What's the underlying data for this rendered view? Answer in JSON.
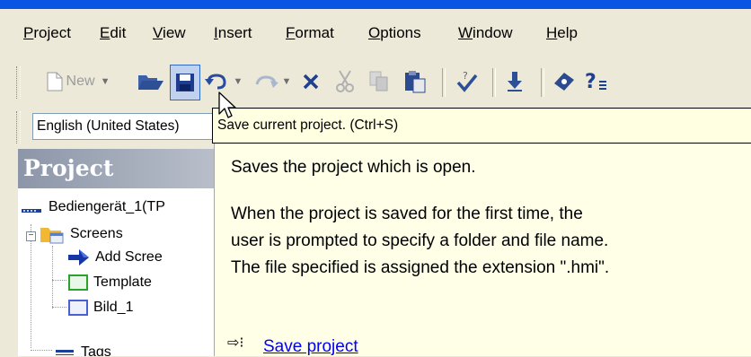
{
  "menu": [
    {
      "label": "Project",
      "mnemonic": "P"
    },
    {
      "label": "Edit",
      "mnemonic": "E"
    },
    {
      "label": "View",
      "mnemonic": "V"
    },
    {
      "label": "Insert",
      "mnemonic": "I"
    },
    {
      "label": "Format",
      "mnemonic": "F"
    },
    {
      "label": "Options",
      "mnemonic": "O"
    },
    {
      "label": "Window",
      "mnemonic": "W"
    },
    {
      "label": "Help",
      "mnemonic": "H"
    }
  ],
  "toolbar": {
    "new_label": "New",
    "icons": [
      "new-document-icon",
      "open-folder-icon",
      "save-icon",
      "undo-icon",
      "redo-icon",
      "delete-icon",
      "cut-icon",
      "copy-icon",
      "paste-icon",
      "check-icon",
      "download-icon",
      "help-book-icon",
      "whats-this-icon"
    ],
    "accent": "#316ac5"
  },
  "language": {
    "value": "English (United States)"
  },
  "tooltip": {
    "title": "Save current project. (Ctrl+S)",
    "summary": "Saves the project which is open.",
    "lines": [
      "When the project is saved for the first time, the",
      "user is prompted to specify a folder and file name.",
      "The file specified is assigned the extension \".hmi\"."
    ],
    "link": "Save project",
    "background": "#ffffe1"
  },
  "project_pane": {
    "title": "Project",
    "tree": [
      {
        "label": "Bediengerät_1(TP",
        "icon": "device-icon"
      },
      {
        "label": "Screens",
        "icon": "folder-icon"
      },
      {
        "label": "Add Scree",
        "icon": "add-arrow-icon"
      },
      {
        "label": "Template",
        "icon": "template-icon"
      },
      {
        "label": "Bild_1",
        "icon": "screen-icon"
      },
      {
        "label": "Tags",
        "icon": "tags-icon"
      }
    ]
  }
}
